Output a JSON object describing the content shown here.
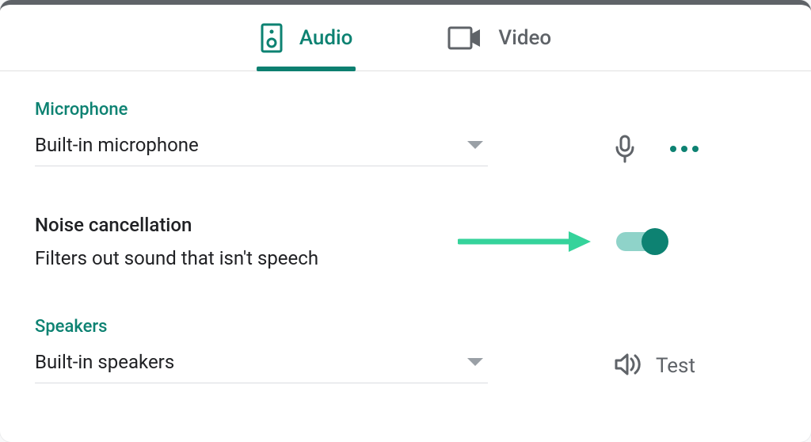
{
  "tabs": {
    "audio": {
      "label": "Audio"
    },
    "video": {
      "label": "Video"
    }
  },
  "microphone": {
    "section": "Microphone",
    "selected": "Built-in microphone"
  },
  "noise": {
    "title": "Noise cancellation",
    "description": "Filters out sound that isn't speech",
    "enabled": true
  },
  "speakers": {
    "section": "Speakers",
    "selected": "Built-in speakers",
    "test_label": "Test"
  }
}
